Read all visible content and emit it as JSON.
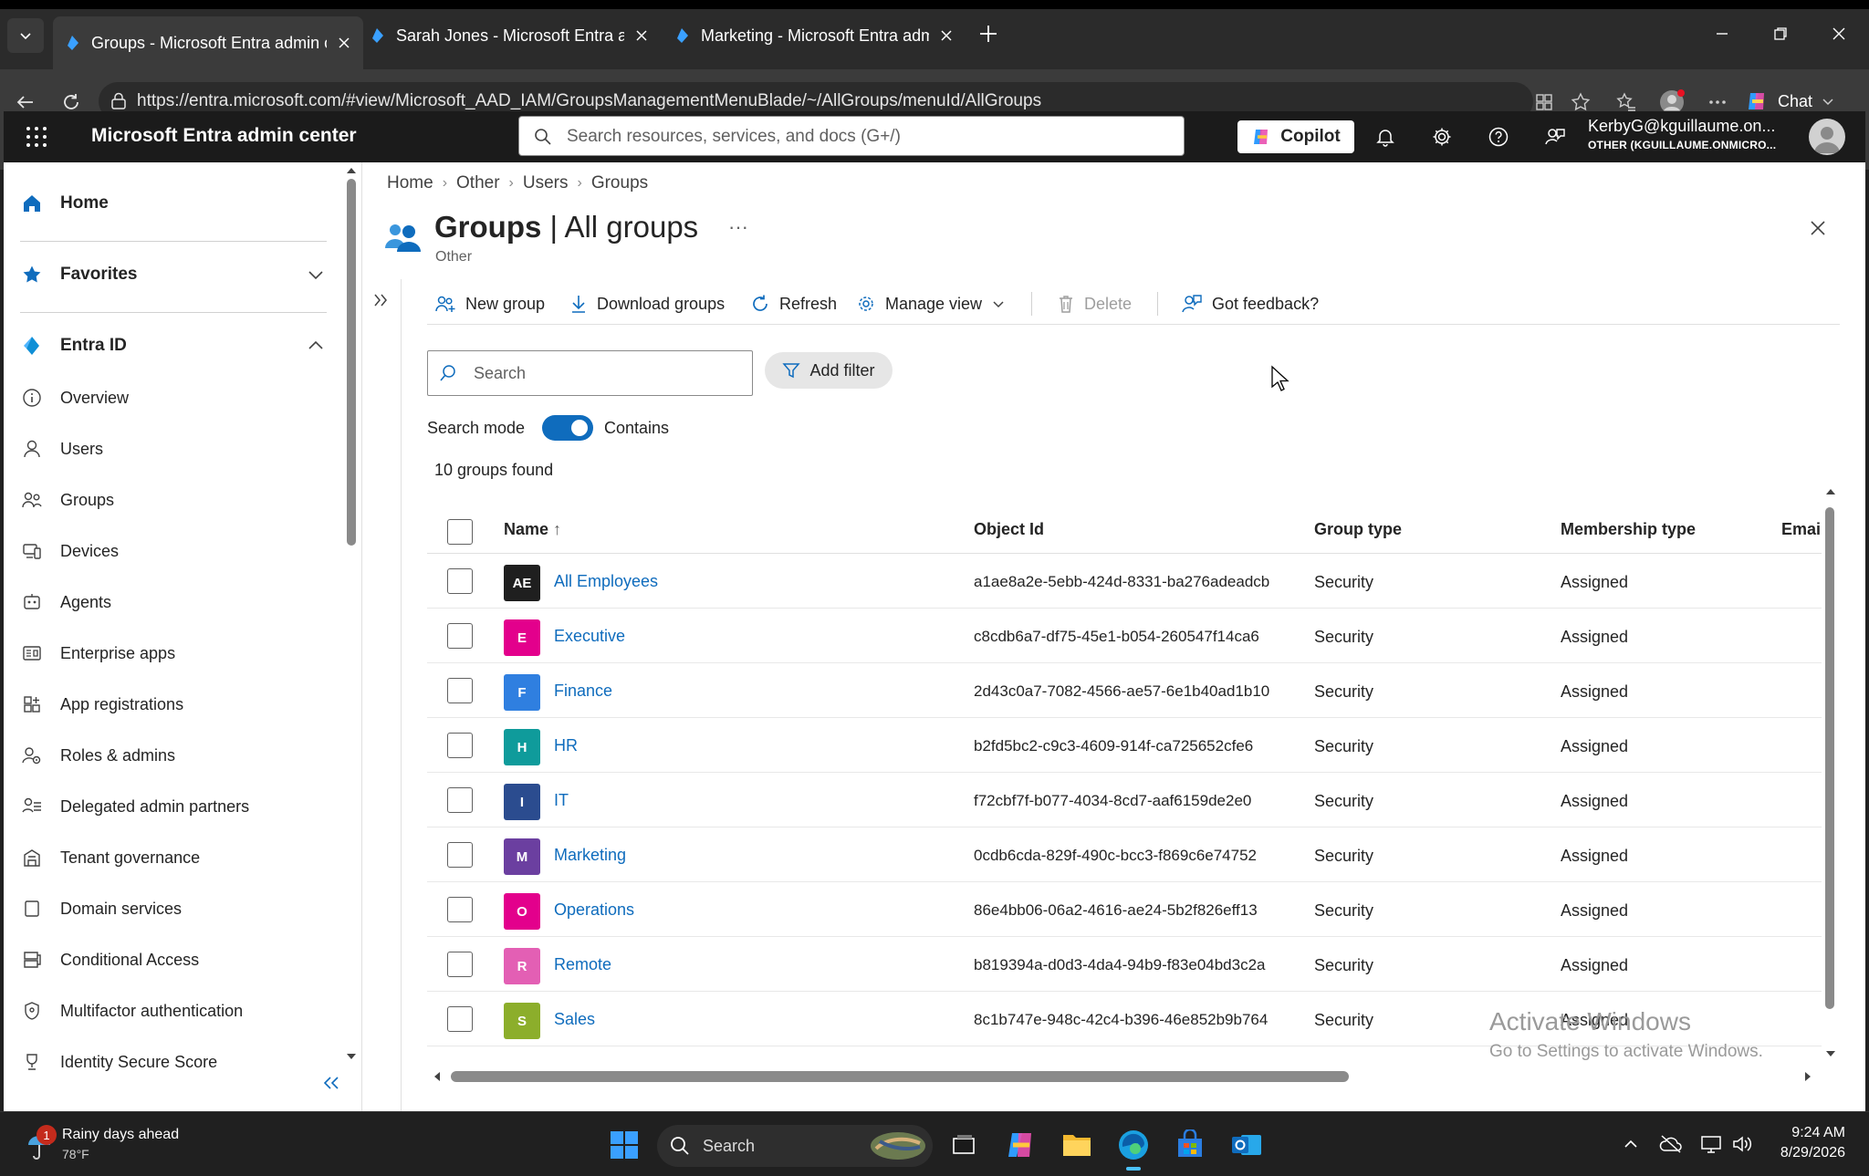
{
  "browser": {
    "tabs": [
      {
        "title": "Groups - Microsoft Entra admin ce",
        "active": true
      },
      {
        "title": "Sarah Jones - Microsoft Entra adm",
        "active": false
      },
      {
        "title": "Marketing - Microsoft Entra admin",
        "active": false
      }
    ],
    "url": "https://entra.microsoft.com/#view/Microsoft_AAD_IAM/GroupsManagementMenuBlade/~/AllGroups/menuId/AllGroups",
    "chat_label": "Chat"
  },
  "portal": {
    "title": "Microsoft Entra admin center",
    "search_placeholder": "Search resources, services, and docs (G+/)",
    "copilot_label": "Copilot",
    "account_name": "KerbyG@kguillaume.on...",
    "account_tenant": "OTHER (KGUILLAUME.ONMICRO..."
  },
  "sidebar": {
    "home": "Home",
    "favorites": "Favorites",
    "entra_id": "Entra ID",
    "items": [
      {
        "label": "Overview",
        "icon": "info-icon"
      },
      {
        "label": "Users",
        "icon": "user-icon"
      },
      {
        "label": "Groups",
        "icon": "groups-icon"
      },
      {
        "label": "Devices",
        "icon": "devices-icon"
      },
      {
        "label": "Agents",
        "icon": "agents-icon"
      },
      {
        "label": "Enterprise apps",
        "icon": "enterprise-apps-icon"
      },
      {
        "label": "App registrations",
        "icon": "app-registrations-icon"
      },
      {
        "label": "Roles & admins",
        "icon": "roles-icon"
      },
      {
        "label": "Delegated admin partners",
        "icon": "partners-icon"
      },
      {
        "label": "Tenant governance",
        "icon": "governance-icon"
      },
      {
        "label": "Domain services",
        "icon": "domain-icon"
      },
      {
        "label": "Conditional Access",
        "icon": "conditional-access-icon"
      },
      {
        "label": "Multifactor authentication",
        "icon": "mfa-icon"
      },
      {
        "label": "Identity Secure Score",
        "icon": "trophy-icon"
      }
    ]
  },
  "blade": {
    "breadcrumb": [
      "Home",
      "Other",
      "Users",
      "Groups"
    ],
    "title_main": "Groups",
    "title_sep": " | ",
    "title_sub": "All groups",
    "subtitle": "Other",
    "more": "···",
    "commands": {
      "new_group": "New group",
      "download_groups": "Download groups",
      "refresh": "Refresh",
      "manage_view": "Manage view",
      "delete": "Delete",
      "feedback": "Got feedback?"
    },
    "search_placeholder": "Search",
    "add_filter": "Add filter",
    "search_mode_label": "Search mode",
    "search_mode_value": "Contains",
    "found_count": "10 groups found"
  },
  "table": {
    "columns": {
      "name": "Name",
      "sort_indicator": "↑",
      "object_id": "Object Id",
      "group_type": "Group type",
      "membership_type": "Membership type",
      "email": "Emai"
    },
    "rows": [
      {
        "initials": "AE",
        "color": "#1f1f1f",
        "name": "All Employees",
        "object_id": "a1ae8a2e-5ebb-424d-8331-ba276adeadcb",
        "group_type": "Security",
        "membership_type": "Assigned"
      },
      {
        "initials": "E",
        "color": "#e3008c",
        "name": "Executive",
        "object_id": "c8cdb6a7-df75-45e1-b054-260547f14ca6",
        "group_type": "Security",
        "membership_type": "Assigned"
      },
      {
        "initials": "F",
        "color": "#2f7fe0",
        "name": "Finance",
        "object_id": "2d43c0a7-7082-4566-ae57-6e1b40ad1b10",
        "group_type": "Security",
        "membership_type": "Assigned"
      },
      {
        "initials": "H",
        "color": "#0f9b9b",
        "name": "HR",
        "object_id": "b2fd5bc2-c9c3-4609-914f-ca725652cfe6",
        "group_type": "Security",
        "membership_type": "Assigned"
      },
      {
        "initials": "I",
        "color": "#2b4c8f",
        "name": "IT",
        "object_id": "f72cbf7f-b077-4034-8cd7-aaf6159de2e0",
        "group_type": "Security",
        "membership_type": "Assigned"
      },
      {
        "initials": "M",
        "color": "#6b3fa0",
        "name": "Marketing",
        "object_id": "0cdb6cda-829f-490c-bcc3-f869c6e74752",
        "group_type": "Security",
        "membership_type": "Assigned"
      },
      {
        "initials": "O",
        "color": "#e3008c",
        "name": "Operations",
        "object_id": "86e4bb06-06a2-4616-ae24-5b2f826eff13",
        "group_type": "Security",
        "membership_type": "Assigned"
      },
      {
        "initials": "R",
        "color": "#e35fb4",
        "name": "Remote",
        "object_id": "b819394a-d0d3-4da4-94b9-f83e04bd3c2a",
        "group_type": "Security",
        "membership_type": "Assigned"
      },
      {
        "initials": "S",
        "color": "#8cae2b",
        "name": "Sales",
        "object_id": "8c1b747e-948c-42c4-b396-46e852b9b764",
        "group_type": "Security",
        "membership_type": "Assigned"
      }
    ]
  },
  "watermark": {
    "line1": "Activate Windows",
    "line2": "Go to Settings to activate Windows."
  },
  "taskbar": {
    "weather_badge": "1",
    "weather_title": "Rainy days ahead",
    "weather_temp": "78°F",
    "search_label": "Search",
    "time": "9:24 AM",
    "date": "8/29/2026"
  },
  "colors": {
    "accent": "#0f6cbd",
    "header_bg": "#1b1b1b",
    "link": "#0f6cbd"
  }
}
